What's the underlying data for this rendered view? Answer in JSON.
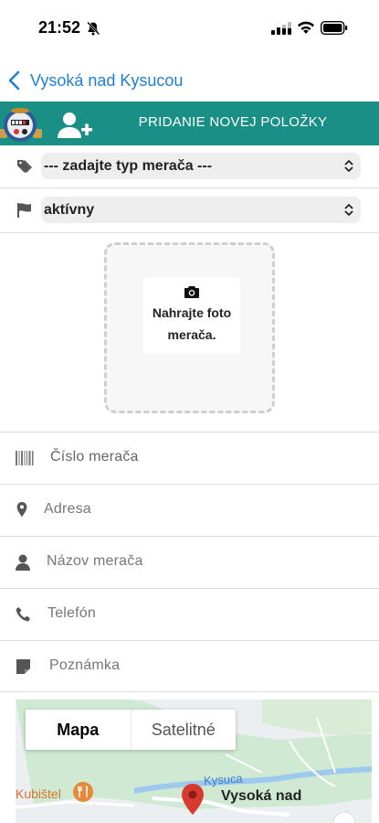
{
  "status": {
    "time": "21:52"
  },
  "nav": {
    "back_title": "Vysoká nad Kysucou"
  },
  "header": {
    "title": "PRIDANIE NOVEJ POLOŽKY"
  },
  "meter_type": {
    "value": "--- zadajte typ merača ---"
  },
  "status_select": {
    "value": "aktívny"
  },
  "upload": {
    "line1": "Nahrajte foto",
    "line2": "merača."
  },
  "fields": {
    "meter_number": "Číslo merača",
    "address": "Adresa",
    "meter_name": "Názov merača",
    "phone": "Telefón",
    "note": "Poznámka"
  },
  "map": {
    "toggle_map": "Mapa",
    "toggle_satellite": "Satelitné",
    "poi_kubistel": "Kubištel",
    "river_label": "Kysuca",
    "place_label": "Vysoká nad"
  },
  "colors": {
    "accent_blue": "#1e7fd8",
    "header_teal": "#1a8f86",
    "pin_red": "#d93a2e"
  },
  "icons": [
    "bell-off-icon",
    "signal-icon",
    "wifi-icon",
    "battery-icon",
    "chevron-left-icon",
    "water-meter-image",
    "add-user-icon",
    "tags-icon",
    "flag-icon",
    "camera-icon",
    "barcode-icon",
    "map-marker-icon",
    "user-icon",
    "phone-icon",
    "note-icon",
    "restaurant-icon",
    "map-pin-icon"
  ]
}
